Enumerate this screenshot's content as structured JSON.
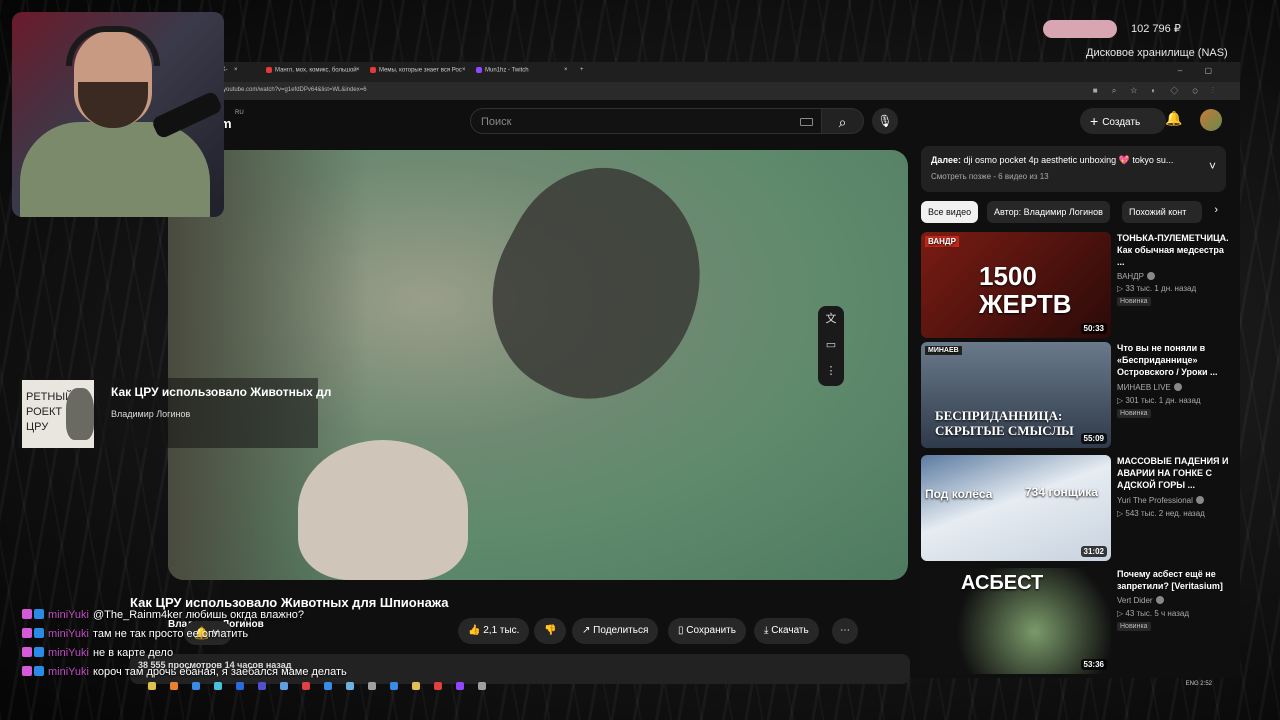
{
  "stream": {
    "balance": "102 796 ₽",
    "nas_label": "Дисковое хранилище (NAS)"
  },
  "browser": {
    "tabs": [
      {
        "label": "Мангл, мох, комикс, большой",
        "icon": "youtube-icon",
        "color": "#e53935"
      },
      {
        "label": "Мемы, которые знает вся Рос",
        "icon": "youtube-icon",
        "color": "#e53935"
      },
      {
        "label": "Mun1hz - Twitch",
        "icon": "twitch-icon",
        "color": "#9146ff"
      }
    ],
    "tab_fragment": "Ж-",
    "url": "youtube.com/watch?v=g1efdDPv64&list=WL&index=6",
    "window_controls": "– ▢"
  },
  "youtube": {
    "logo_fragment": "m",
    "logo_region": "RU",
    "search_placeholder": "Поиск",
    "create_label": "Создать",
    "video_title": "Как ЦРУ использовало Животных для Шпионажа",
    "channel_name": "Владимир Логинов",
    "actions": {
      "likes": "2,1 тыс.",
      "share": "Поделиться",
      "save": "Сохранить",
      "download": "Скачать"
    },
    "description": "38 555 просмотров  14 часов назад"
  },
  "up_next": {
    "label": "Далее:",
    "title": "dji osmo pocket 4p aesthetic unboxing 💖 tokyo su...",
    "subtitle": "Смотреть позже - 6 видео из 13"
  },
  "chips": [
    "Все видео",
    "Автор: Владимир Логинов",
    "Похожий конт"
  ],
  "recommendations": [
    {
      "title": "ТОНЬКА-ПУЛЕМЕТЧИЦА. Как обычная медсестра ...",
      "channel": "ВАНДР",
      "meta": "▷ 33 тыс.  1 дн. назад",
      "badge": "Новинка",
      "duration": "50:33",
      "thumb_text": "1500 ЖЕРТВ",
      "thumb_tag": "ВАНДР",
      "thumb_color": "#5a1612"
    },
    {
      "title": "Что вы не поняли в «Бесприданнице» Островского / Уроки ...",
      "channel": "МИНАЕВ LIVE",
      "meta": "▷ 301 тыс.  1 дн. назад",
      "badge": "Новинка",
      "duration": "55:09",
      "thumb_text": "БЕСПРИДАННИЦА: СКРЫТЫЕ СМЫСЛЫ",
      "thumb_tag": "МИНАЕВ",
      "thumb_color": "#2f3a4a"
    },
    {
      "title": "МАССОВЫЕ ПАДЕНИЯ И АВАРИИ НА ГОНКЕ С АДСКОЙ ГОРЫ ...",
      "channel": "Yuri The Professional",
      "meta": "▷ 543 тыс.  2 нед. назад",
      "badge": "",
      "duration": "31:02",
      "thumb_text": "Под колёса",
      "thumb_text2": "734 гонщика",
      "thumb_color": "#cfd8e3"
    },
    {
      "title": "Почему асбест ещё не запретили? [Veritasium]",
      "channel": "Vert Dider",
      "meta": "▷ 43 тыс.  5 ч назад",
      "badge": "Новинка",
      "duration": "53:36",
      "thumb_text": "АСБЕСТ",
      "thumb_color": "#101010"
    }
  ],
  "overlay_card": {
    "title": "Как ЦРУ использовало Животных дл",
    "author": "Владимир Логинов",
    "thumb_text": "РЕТНЫЙ РОЕКТ ЦРУ"
  },
  "chat": [
    {
      "user": "miniYuki",
      "message": "@The_Rainm4ker любишь окгда влажно?"
    },
    {
      "user": "miniYuki",
      "message": "там не так просто ее оплатить"
    },
    {
      "user": "miniYuki",
      "message": "не в карте дело"
    },
    {
      "user": "miniYuki",
      "message": "короч там дрочь ебаная, я заебался маме делать"
    }
  ],
  "taskbar": {
    "tray_text": "ENG  2:52",
    "icon_colors": [
      "#e0c050",
      "#e88030",
      "#3a8ae8",
      "#4ac0e0",
      "#2a6ae0",
      "#5050d0",
      "#60a0e0",
      "#e04040",
      "#3a8ae8",
      "#70b0e0",
      "#a0a0a0",
      "#3a8ae8",
      "#e0c050",
      "#e04040",
      "#9146ff",
      "#a0a0a0"
    ]
  }
}
